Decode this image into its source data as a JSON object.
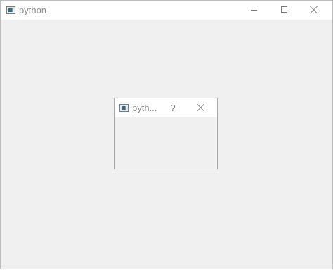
{
  "main_window": {
    "title": "python",
    "icon": "python-app-icon",
    "controls": [
      "minimize-icon",
      "maximize-icon",
      "close-icon"
    ]
  },
  "dialog": {
    "title": "pyth...",
    "icon": "python-app-icon",
    "help_label": "?",
    "controls": [
      "help-button",
      "close-icon"
    ]
  }
}
